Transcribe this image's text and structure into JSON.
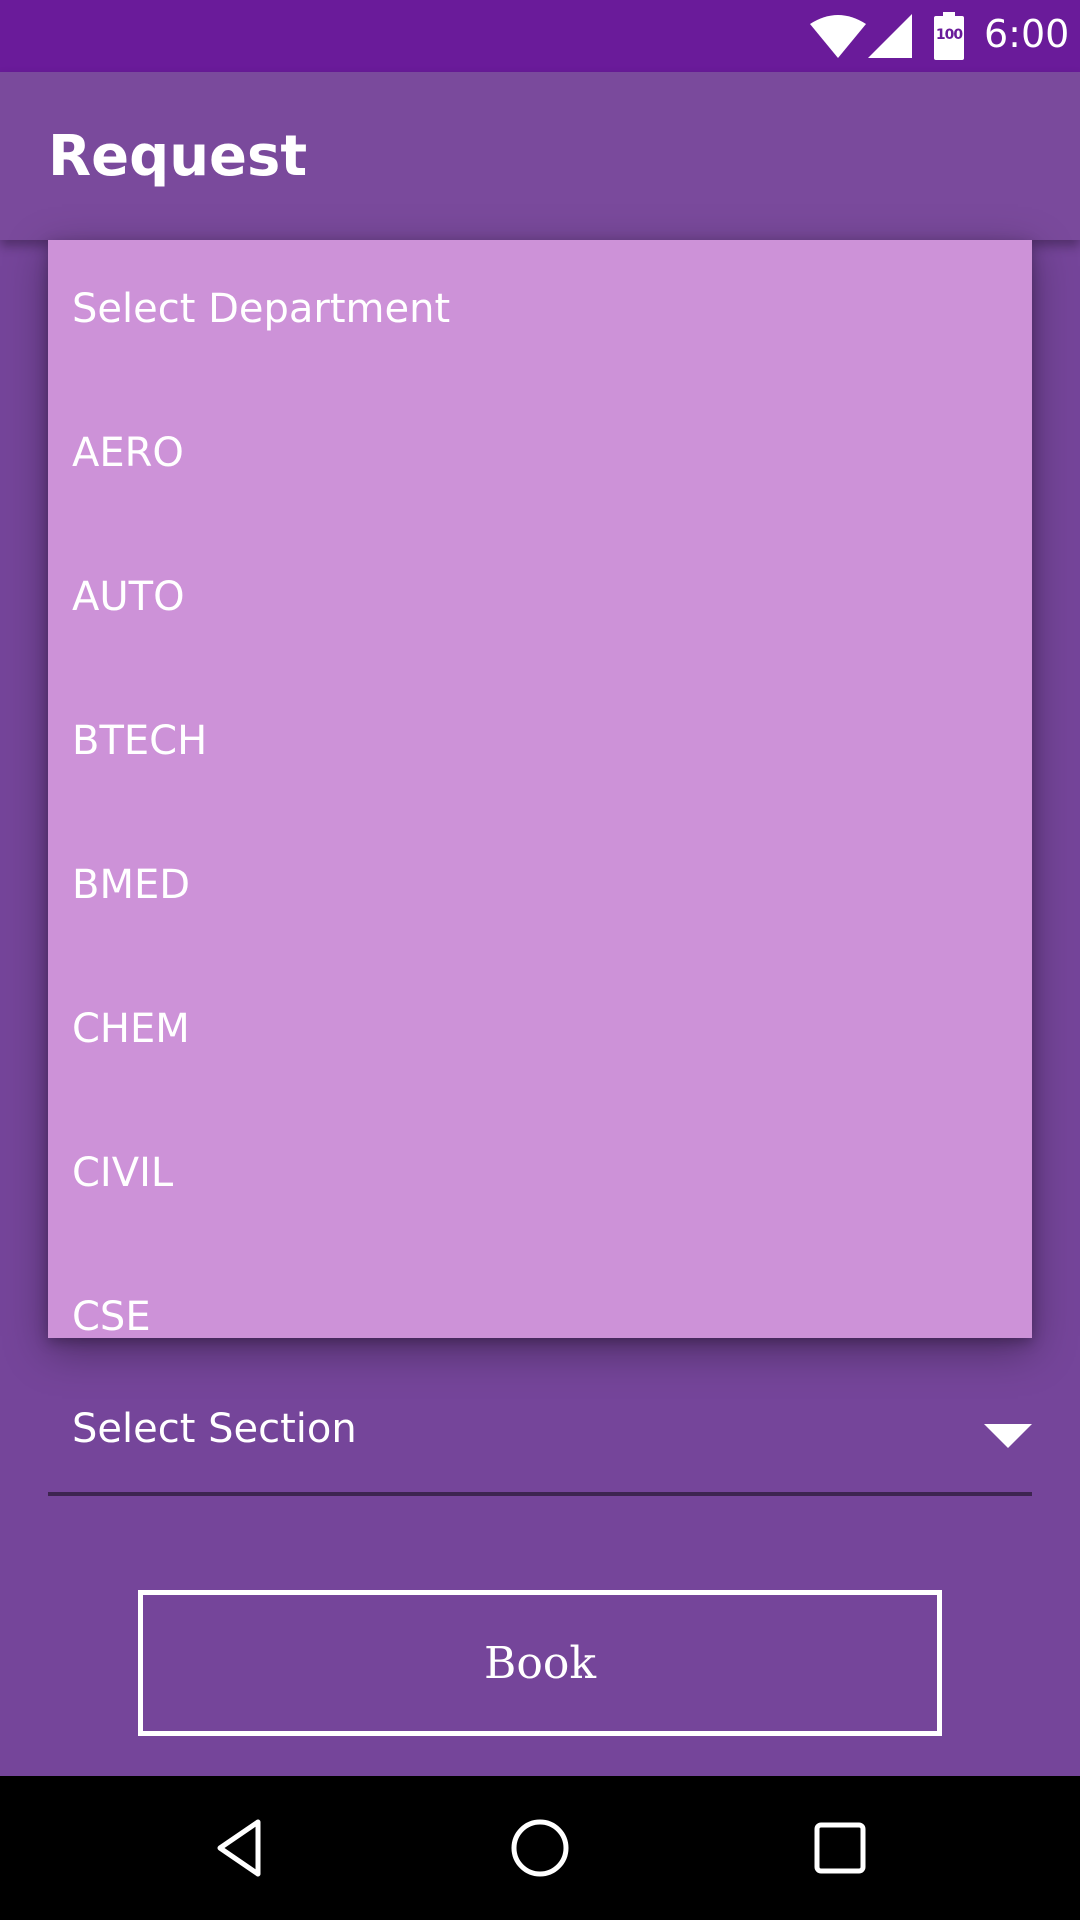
{
  "status_bar": {
    "time": "6:00",
    "battery_level": "100",
    "icons": [
      "wifi-icon",
      "signal-icon",
      "battery-icon"
    ]
  },
  "toolbar": {
    "title": "Request"
  },
  "department_dropdown": {
    "options": [
      "Select Department",
      "AERO",
      "AUTO",
      "BTECH",
      "BMED",
      "CHEM",
      "CIVIL",
      "CSE"
    ]
  },
  "section_spinner": {
    "selected": "Select Section"
  },
  "book_button": {
    "label": "Book"
  },
  "nav_bar": {
    "icons": [
      "back-icon",
      "home-icon",
      "recents-icon"
    ]
  },
  "colors": {
    "status_bar": "#6a1b9a",
    "toolbar": "#7a4a9c",
    "background": "#75459a",
    "dropdown": "#cd92d8",
    "nav_bar": "#000000"
  }
}
